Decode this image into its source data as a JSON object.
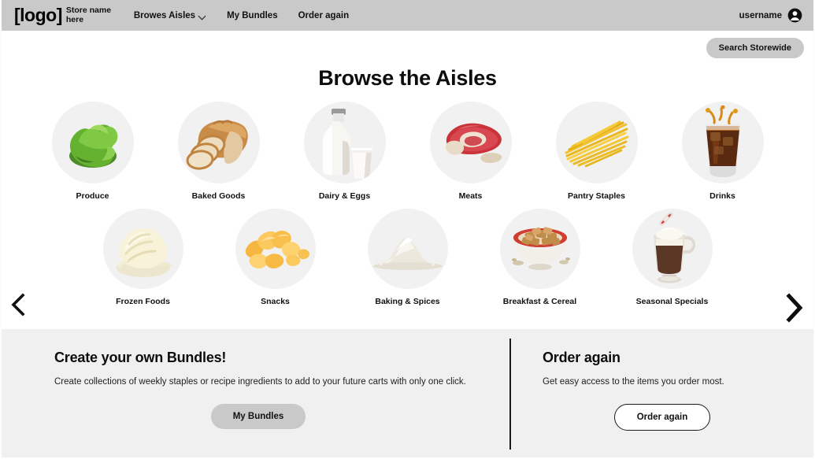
{
  "header": {
    "logo_text": "[logo]",
    "store_name": "Store name here",
    "nav": [
      {
        "label": "Browes Aisles",
        "has_dropdown": true
      },
      {
        "label": "My Bundles",
        "has_dropdown": false
      },
      {
        "label": "Order again",
        "has_dropdown": false
      }
    ],
    "username": "username",
    "avatar_icon": "user-avatar-icon"
  },
  "search": {
    "button_label": "Search Storewide"
  },
  "main": {
    "title": "Browse the Aisles",
    "prev_arrow_icon": "chevron-left-icon",
    "next_arrow_icon": "chevron-right-icon",
    "categories_row1": [
      {
        "label": "Produce",
        "image": "lettuce-photo"
      },
      {
        "label": "Baked Goods",
        "image": "sliced-bread-photo"
      },
      {
        "label": "Dairy & Eggs",
        "image": "milk-bottle-and-glass-photo"
      },
      {
        "label": "Meats",
        "image": "raw-steak-photo"
      },
      {
        "label": "Pantry Staples",
        "image": "spaghetti-photo"
      },
      {
        "label": "Drinks",
        "image": "cola-glass-photo"
      }
    ],
    "categories_row2": [
      {
        "label": "Frozen Foods",
        "image": "ice-cream-scoop-photo"
      },
      {
        "label": "Snacks",
        "image": "potato-chips-photo"
      },
      {
        "label": "Baking & Spices",
        "image": "flour-pile-photo"
      },
      {
        "label": "Breakfast & Cereal",
        "image": "cereal-bowl-photo"
      },
      {
        "label": "Seasonal Specials",
        "image": "hot-cocoa-mug-photo"
      }
    ]
  },
  "bottom": {
    "bundles": {
      "heading": "Create your own Bundles!",
      "description": "Create collections of weekly staples or recipe ingredients to add to your future carts with only one click.",
      "button_label": "My Bundles"
    },
    "order_again": {
      "heading": "Order again",
      "description": "Get easy access to the items you order most.",
      "button_label": "Order again"
    }
  },
  "colors": {
    "header_bg": "#c9c9c9",
    "page_bg": "#ffffff",
    "bottom_bg": "#f0f0f0",
    "circle_bg": "#f1f1f1",
    "text": "#111111"
  }
}
